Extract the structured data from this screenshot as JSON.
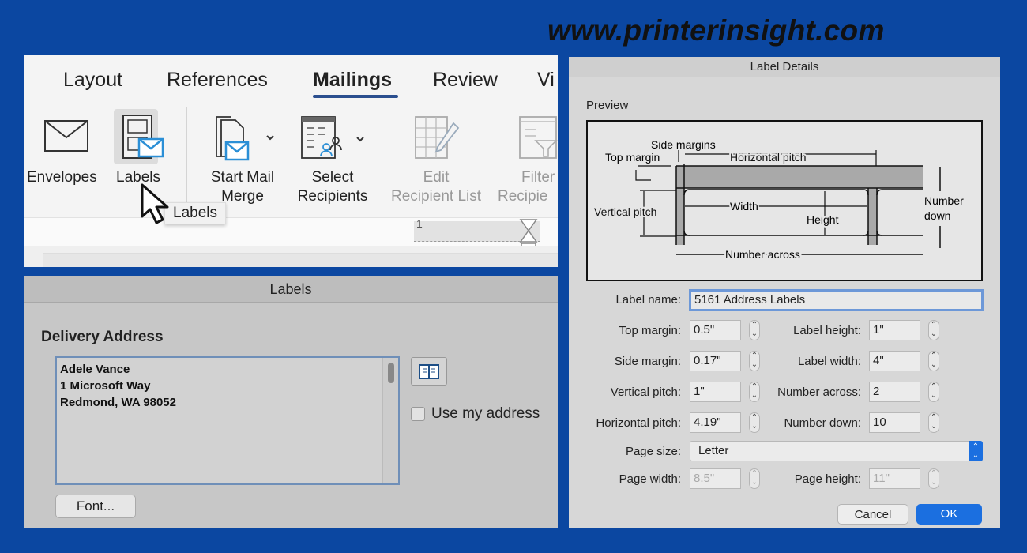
{
  "watermark": "www.printerinsight.com",
  "ribbon": {
    "tabs": [
      {
        "label": "Layout"
      },
      {
        "label": "References"
      },
      {
        "label": "Mailings",
        "active": true
      },
      {
        "label": "Review"
      },
      {
        "label": "Vi"
      }
    ],
    "buttons": [
      {
        "label": "Envelopes",
        "icon": "envelope-icon"
      },
      {
        "label": "Labels",
        "icon": "labels-icon",
        "selected": true
      },
      {
        "label_line1": "Start Mail",
        "label_line2": "Merge",
        "icon": "start-mail-merge-icon"
      },
      {
        "label_line1": "Select",
        "label_line2": "Recipients",
        "icon": "select-recipients-icon"
      },
      {
        "label_line1": "Edit",
        "label_line2": "Recipient List",
        "icon": "edit-list-icon",
        "disabled": true
      },
      {
        "label_line1": "Filter",
        "label_line2": "Recipie",
        "icon": "filter-icon",
        "disabled": true
      }
    ],
    "tooltip": "Labels",
    "ruler_mark": "1"
  },
  "labels_dialog": {
    "title": "Labels",
    "section": "Delivery Address",
    "address": "Adele Vance\n1 Microsoft Way\nRedmond, WA 98052",
    "use_my_address": "Use my address",
    "use_my_address_checked": false,
    "font_button": "Font..."
  },
  "label_details": {
    "title": "Label Details",
    "preview_label": "Preview",
    "diagram": {
      "side_margins": "Side margins",
      "top_margin": "Top margin",
      "horizontal_pitch": "Horizontal pitch",
      "vertical_pitch": "Vertical pitch",
      "width": "Width",
      "height": "Height",
      "number_down_1": "Number",
      "number_down_2": "down",
      "number_across": "Number across"
    },
    "label_name": {
      "label": "Label name:",
      "value": "5161 Address Labels"
    },
    "left_fields": [
      {
        "label": "Top margin:",
        "value": "0.5\""
      },
      {
        "label": "Side margin:",
        "value": "0.17\""
      },
      {
        "label": "Vertical pitch:",
        "value": "1\""
      },
      {
        "label": "Horizontal pitch:",
        "value": "4.19\""
      }
    ],
    "right_fields": [
      {
        "label": "Label height:",
        "value": "1\""
      },
      {
        "label": "Label width:",
        "value": "4\""
      },
      {
        "label": "Number across:",
        "value": "2"
      },
      {
        "label": "Number down:",
        "value": "10"
      }
    ],
    "page_size": {
      "label": "Page size:",
      "value": "Letter"
    },
    "page_width": {
      "label": "Page width:",
      "value": "8.5\"",
      "disabled": true
    },
    "page_height": {
      "label": "Page height:",
      "value": "11\"",
      "disabled": true
    },
    "cancel": "Cancel",
    "ok": "OK",
    "accent": "#1b6fe0"
  }
}
